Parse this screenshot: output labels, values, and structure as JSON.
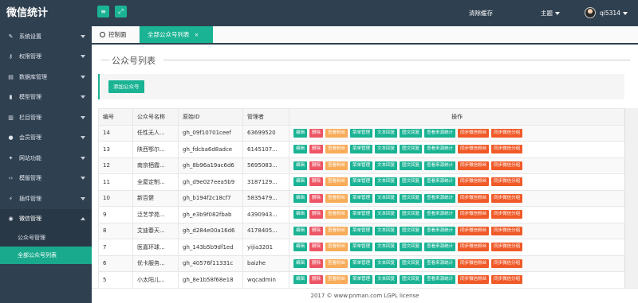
{
  "app": {
    "title": "微信统计"
  },
  "sidebar": {
    "items": [
      {
        "label": "系统设置",
        "icon": "wrench-icon",
        "glyph": "✎"
      },
      {
        "label": "权限管理",
        "icon": "key-icon",
        "glyph": "⚷"
      },
      {
        "label": "数据库管理",
        "icon": "database-icon",
        "glyph": "▤"
      },
      {
        "label": "模型管理",
        "icon": "book-icon",
        "glyph": "▮"
      },
      {
        "label": "栏目管理",
        "icon": "columns-icon",
        "glyph": "▥"
      },
      {
        "label": "会员管理",
        "icon": "user-icon",
        "glyph": "●"
      },
      {
        "label": "网站功能",
        "icon": "puzzle-icon",
        "glyph": "✦"
      },
      {
        "label": "模版管理",
        "icon": "code-icon",
        "glyph": "‹›"
      },
      {
        "label": "插件管理",
        "icon": "plug-icon",
        "glyph": "⚡"
      },
      {
        "label": "微信管理",
        "icon": "wechat-icon",
        "glyph": "◉"
      }
    ],
    "sub_items": [
      {
        "label": "公众号管理"
      },
      {
        "label": "全部公众号列表"
      }
    ]
  },
  "topbar": {
    "menu_icon": "≡",
    "expand_icon": "⤢",
    "clear_cache": "清除缓存",
    "theme": "主题",
    "username": "qi5314"
  },
  "tabs": [
    {
      "label": "控制面板"
    },
    {
      "label": "全部公众号列表",
      "close": "×"
    }
  ],
  "page": {
    "title": "公众号列表",
    "add_button": "添加公众号"
  },
  "table": {
    "headers": [
      "编号",
      "公众号名称",
      "原始ID",
      "管理者",
      "操作"
    ],
    "actions": [
      {
        "label": "编辑",
        "color": "green"
      },
      {
        "label": "删除",
        "color": "red"
      },
      {
        "label": "查看粉丝",
        "color": "yellow"
      },
      {
        "label": "菜单管理",
        "color": "green"
      },
      {
        "label": "文本回复",
        "color": "green"
      },
      {
        "label": "图文回复",
        "color": "green"
      },
      {
        "label": "查看来源统计",
        "color": "green"
      },
      {
        "label": "同步微信粉丝",
        "color": "orange"
      },
      {
        "label": "同步微信分组",
        "color": "orange"
      }
    ],
    "rows": [
      {
        "id": "14",
        "name": "任性无人...",
        "orig_id": "gh_09f10701ceef",
        "manager": "63699520"
      },
      {
        "id": "13",
        "name": "陕西鄂尔...",
        "orig_id": "gh_fdcba6d8adce",
        "manager": "6145107..."
      },
      {
        "id": "12",
        "name": "南京栖霞...",
        "orig_id": "gh_8b96a19ac6d6",
        "manager": "5695083..."
      },
      {
        "id": "11",
        "name": "全屋定制...",
        "orig_id": "gh_d9e027eea5b9",
        "manager": "3187129..."
      },
      {
        "id": "10",
        "name": "新百健",
        "orig_id": "gh_b194f2c18cf7",
        "manager": "5835479..."
      },
      {
        "id": "9",
        "name": "泛艺学苑...",
        "orig_id": "gh_e3b9f082fbab",
        "manager": "4390943..."
      },
      {
        "id": "8",
        "name": "艾迪春天...",
        "orig_id": "gh_d284e00a16d6",
        "manager": "4178405..."
      },
      {
        "id": "7",
        "name": "医嘉环球...",
        "orig_id": "gh_143b5b9df1ed",
        "manager": "yijia3201"
      },
      {
        "id": "6",
        "name": "优卡服务...",
        "orig_id": "gh_40576f11331c",
        "manager": "baizhe"
      },
      {
        "id": "5",
        "name": "小太阳儿...",
        "orig_id": "gh_8e1b58f68e18",
        "manager": "wqcadmin"
      }
    ]
  },
  "footer": {
    "text": "2017 © www.pnman.com  LGPL license"
  },
  "colors": {
    "sidebar_bg": "#2f4050",
    "accent": "#1ab394",
    "danger": "#ed5565",
    "warning": "#f8ac59",
    "orange": "#f05a28"
  }
}
